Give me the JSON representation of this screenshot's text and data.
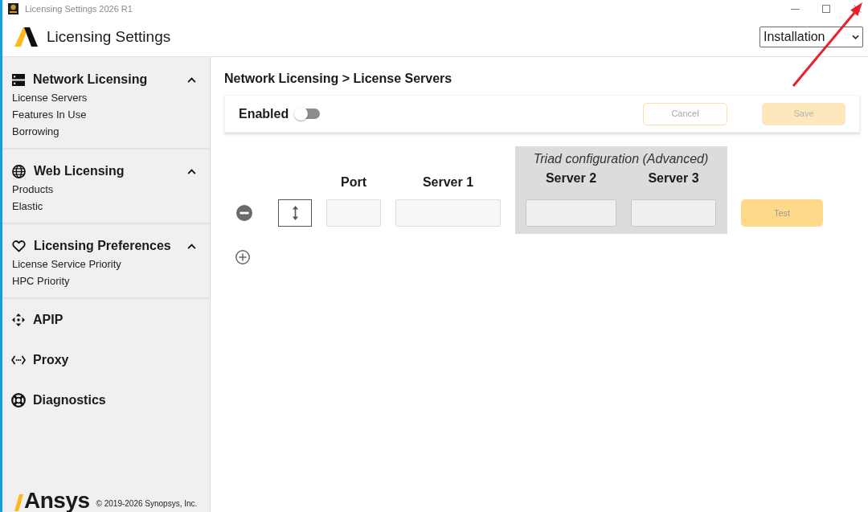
{
  "window": {
    "title": "Licensing Settings 2026 R1"
  },
  "header": {
    "title": "Licensing Settings",
    "edition_select": {
      "value": "Installation"
    }
  },
  "sidebar": {
    "items": [
      {
        "kind": "group",
        "title": "Network Licensing",
        "expanded": true,
        "children": [
          {
            "label": "License Servers"
          },
          {
            "label": "Features In Use"
          },
          {
            "label": "Borrowing"
          }
        ]
      },
      {
        "kind": "group",
        "title": "Web Licensing",
        "expanded": true,
        "children": [
          {
            "label": "Products"
          },
          {
            "label": "Elastic"
          }
        ]
      },
      {
        "kind": "group",
        "title": "Licensing Preferences",
        "expanded": true,
        "children": [
          {
            "label": "License Service Priority"
          },
          {
            "label": "HPC Priority"
          }
        ]
      },
      {
        "kind": "link",
        "title": "APIP"
      },
      {
        "kind": "link",
        "title": "Proxy"
      },
      {
        "kind": "link",
        "title": "Diagnostics"
      }
    ],
    "footer": {
      "logo_text": "Ansys",
      "copyright": "© 2019-2026 Synopsys, Inc."
    }
  },
  "content": {
    "breadcrumb": "Network Licensing > License Servers",
    "toolbar": {
      "toggle": {
        "label": "Enabled",
        "on": false
      },
      "buttons": [
        {
          "label": "Cancel",
          "kind": "outline",
          "disabled": true
        },
        {
          "label": "Save",
          "kind": "filled",
          "disabled": true
        }
      ]
    },
    "servers": {
      "triad_title": "Triad configuration (Advanced)",
      "columns": [
        {
          "label": "Port",
          "triad": false
        },
        {
          "label": "Server 1",
          "triad": false
        },
        {
          "label": "Server 2",
          "triad": true
        },
        {
          "label": "Server 3",
          "triad": true
        }
      ],
      "rows": [
        {
          "test_label": "Test"
        }
      ]
    }
  }
}
